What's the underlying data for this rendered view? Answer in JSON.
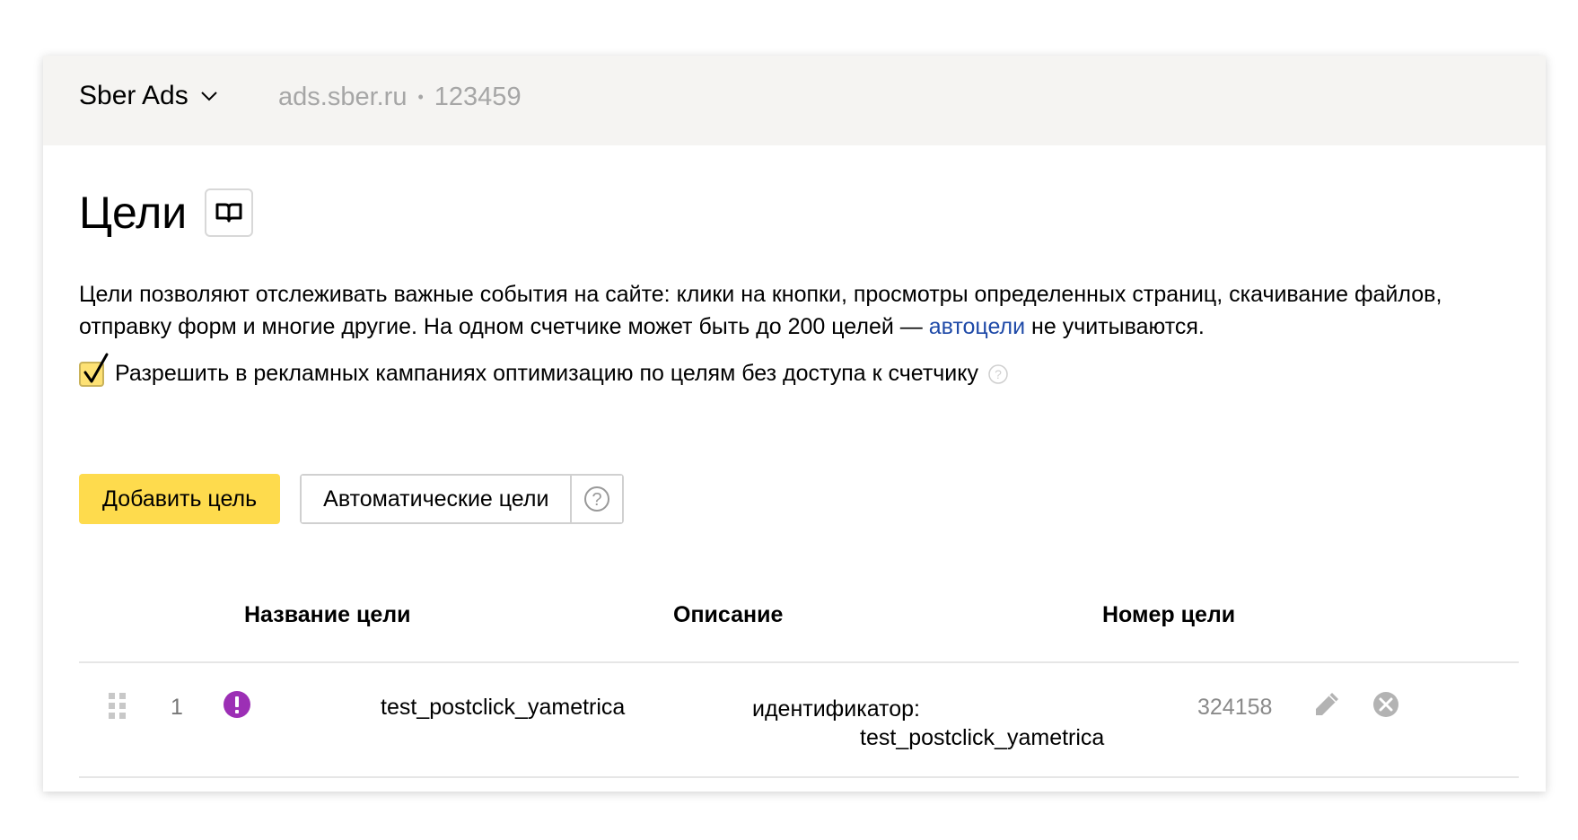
{
  "header": {
    "counter_name": "Sber Ads",
    "site": "ads.sber.ru",
    "separator": "•",
    "counter_id": "123459"
  },
  "page": {
    "title": "Цели",
    "description_text": "Цели позволяют отслеживать важные события на сайте: клики на кнопки, просмотры определенных страниц, скачивание файлов, отправку форм и многие другие. На одном счетчике может быть до 200 целей — ",
    "description_link": "автоцели",
    "description_tail": " не учитываются.",
    "option_label": "Разрешить в рекламных кампаниях оптимизацию по целям без доступа к счетчику",
    "option_checked": true
  },
  "buttons": {
    "add_goal": "Добавить цель",
    "auto_goals": "Автоматические цели"
  },
  "table": {
    "columns": [
      "Название цели",
      "Описание",
      "Номер цели"
    ],
    "rows": [
      {
        "index": "1",
        "name": "test_postclick_yametrica",
        "description_line1": "идентификатор:",
        "description_line2": "test_postclick_yametrica",
        "number": "324158"
      }
    ]
  },
  "colors": {
    "accent_yellow": "#fedb4d",
    "link_blue": "#1f4aa8",
    "warning_purple": "#9c2fb5",
    "header_bg": "#f5f4f2"
  },
  "icons": [
    "chevron-down-icon",
    "book-icon",
    "checkmark-icon",
    "question-icon",
    "drag-handle-icon",
    "warning-icon",
    "pencil-icon",
    "close-circle-icon"
  ]
}
